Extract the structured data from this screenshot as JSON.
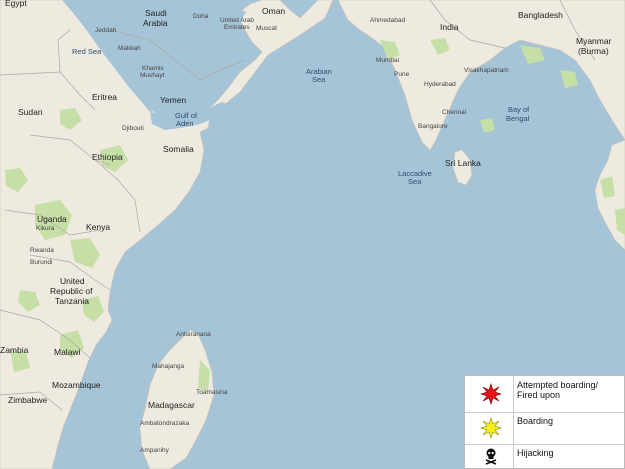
{
  "map": {
    "labels": {
      "egypt": "Egypt",
      "saudi_arabia": "Saudi\nArabia",
      "jeddah": "Jeddah",
      "makkah": "Makkah",
      "khamis": "Khamis\nMushayt",
      "red_sea": "Red Sea",
      "sudan": "Sudan",
      "eritrea": "Eritrea",
      "yemen": "Yemen",
      "gulf_of_aden": "Gulf of\nAden",
      "djibouti": "Djibouti",
      "ethiopia": "Ethiopia",
      "somalia": "Somalia",
      "uganda": "Uganda",
      "kikura": "Kikura",
      "kenya": "Kenya",
      "rwanda": "Rwanda",
      "burundi": "Burundi",
      "tanzania": "United\nRepublic of\nTanzania",
      "zambia": "Zambia",
      "malawi": "Malawi",
      "mozambique": "Mozambique",
      "zimbabwe": "Zimbabwe",
      "madagascar": "Madagascar",
      "doha": "Doha",
      "uae": "United Arab\nEmirates",
      "oman": "Oman",
      "muscat": "Muscat",
      "arabian_sea": "Arabian\nSea",
      "india": "India",
      "ahmedabad": "Ahmedabad",
      "mumbai": "Mumbai",
      "pune": "Pune",
      "hyderabad": "Hyderabad",
      "bangalore": "Bangalore",
      "chennai": "Chennai",
      "laccadive_sea": "Laccadive\nSea",
      "sri_lanka": "Sri Lanka",
      "bangladesh": "Bangladesh",
      "myanmar": "Myanmar\n(Burma)",
      "bay_of_bengal": "Bay of\nBengal",
      "visakhapatnam": "Visakhapatnam",
      "antsiranana": "Antsiranana",
      "mahajanga": "Mahajanga",
      "toamasina": "Toamasina",
      "ambatondrazaka": "Ambatondrazaka",
      "ambovombe": "Ampanihy"
    }
  },
  "legend": {
    "items": [
      {
        "label": "Attempted boarding/\nFired upon",
        "icon": "red-starburst-icon",
        "color": "#e8141b"
      },
      {
        "label": "Boarding",
        "icon": "yellow-starburst-icon",
        "color": "#f5ee1a"
      },
      {
        "label": "Hijacking",
        "icon": "skull-crossbones-icon",
        "color": "#111111"
      }
    ]
  },
  "colors": {
    "water": "#a6c4d8",
    "land": "#eeeae0",
    "forest": "#c6dfa6",
    "border": "#b0a7a0"
  }
}
